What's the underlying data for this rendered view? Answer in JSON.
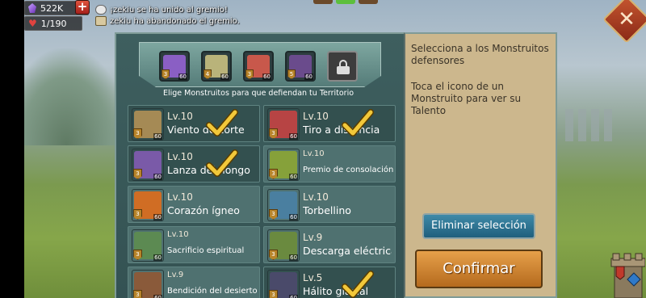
{
  "status": {
    "gems": "522K",
    "population": "1/190",
    "add_label": "+"
  },
  "chat": [
    {
      "text": "¡zekiu se ha unido al gremio!"
    },
    {
      "text": "zekiu ha abandonado el gremio."
    }
  ],
  "close_label": "✕",
  "defense": {
    "instruction": "Elige Monstruitos para que defiendan tu Territorio",
    "slots": [
      {
        "level": "60",
        "stars": "3",
        "color": "#8a5fc4"
      },
      {
        "level": "60",
        "stars": "4",
        "color": "#b9b37a"
      },
      {
        "level": "60",
        "stars": "3",
        "color": "#c8584b"
      },
      {
        "level": "60",
        "stars": "5",
        "color": "#6a4b8c"
      }
    ]
  },
  "monsters": [
    {
      "lv": "Lv.10",
      "name": "Viento de corte",
      "level": "60",
      "stars": "3",
      "color": "#a58a55",
      "selected": true
    },
    {
      "lv": "Lv.10",
      "name": "Tiro a distancia",
      "level": "60",
      "stars": "3",
      "color": "#b74444",
      "selected": true
    },
    {
      "lv": "Lv.10",
      "name": "Lanza del hongo",
      "level": "60",
      "stars": "3",
      "color": "#7a5aa8",
      "selected": true
    },
    {
      "lv": "Lv.10",
      "name": "Premio de consolación",
      "level": "60",
      "stars": "3",
      "color": "#86a13a",
      "selected": false
    },
    {
      "lv": "Lv.10",
      "name": "Corazón ígneo",
      "level": "60",
      "stars": "3",
      "color": "#d06d24",
      "selected": false
    },
    {
      "lv": "Lv.10",
      "name": "Torbellino",
      "level": "60",
      "stars": "3",
      "color": "#4a7fa0",
      "selected": false
    },
    {
      "lv": "Lv.10",
      "name": "Sacrificio espiritual",
      "level": "60",
      "stars": "3",
      "color": "#5c8a52",
      "selected": false
    },
    {
      "lv": "Lv.9",
      "name": "Descarga eléctrica",
      "level": "60",
      "stars": "3",
      "color": "#6a8a3f",
      "selected": false
    },
    {
      "lv": "Lv.9",
      "name": "Bendición del desierto",
      "level": "60",
      "stars": "3",
      "color": "#8a5a3a",
      "selected": false
    },
    {
      "lv": "Lv.5",
      "name": "Hálito glacial",
      "level": "60",
      "stars": "3",
      "color": "#4a4a6a",
      "selected": true
    }
  ],
  "side": {
    "hint1": "Selecciona a los Monstruitos defensores",
    "hint2": "Toca el icono de un Monstruito para ver su Talento",
    "clear_label": "Eliminar selección",
    "confirm_label": "Confirmar"
  }
}
